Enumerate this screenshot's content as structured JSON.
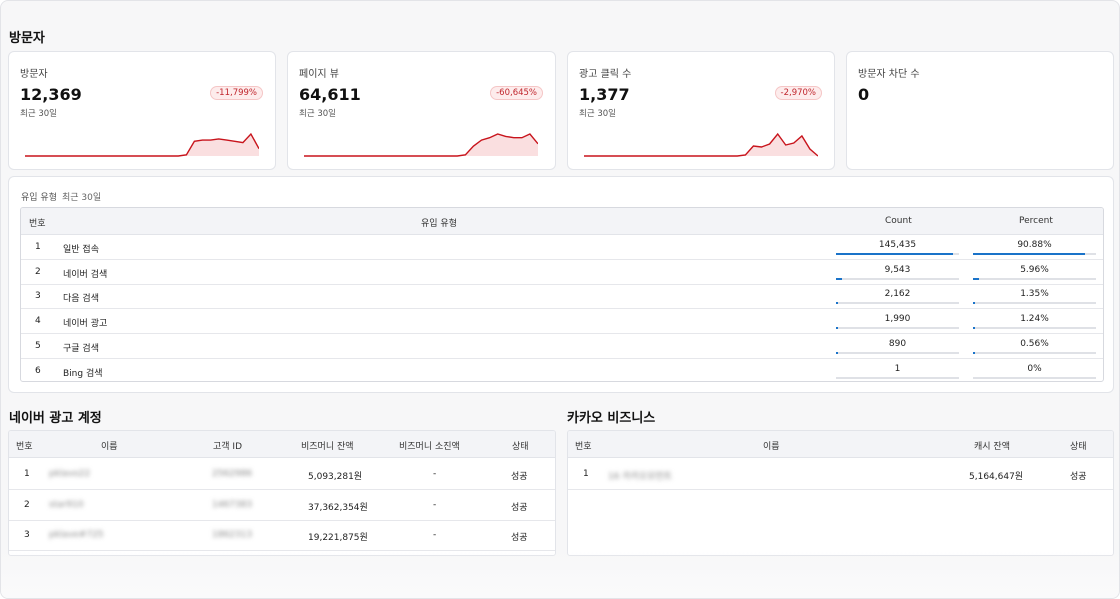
{
  "page": {
    "section_visitor": "방문자"
  },
  "kpis": [
    {
      "label": "방문자",
      "value": "12,369",
      "sub": "최근 30일",
      "badge": "-11,799%",
      "trend": [
        0,
        0,
        0,
        0,
        0,
        0,
        0,
        0,
        0,
        0,
        0,
        0,
        0,
        0,
        0,
        0,
        0,
        0,
        0,
        0,
        1,
        12,
        13,
        13,
        14,
        13,
        12,
        11,
        18,
        6
      ]
    },
    {
      "label": "페이지 뷰",
      "value": "64,611",
      "sub": "최근 30일",
      "badge": "-60,645%",
      "trend": [
        0,
        0,
        0,
        0,
        0,
        0,
        0,
        0,
        0,
        0,
        0,
        0,
        0,
        0,
        0,
        0,
        0,
        0,
        0,
        0,
        1,
        8,
        13,
        15,
        18,
        16,
        15,
        15,
        18,
        10
      ]
    },
    {
      "label": "광고 클릭 수",
      "value": "1,377",
      "sub": "최근 30일",
      "badge": "-2,970%",
      "trend": [
        0,
        0,
        0,
        0,
        0,
        0,
        0,
        0,
        0,
        0,
        0,
        0,
        0,
        0,
        0,
        0,
        0,
        0,
        0,
        0,
        1,
        10,
        9,
        12,
        22,
        11,
        13,
        20,
        7,
        0
      ]
    },
    {
      "label": "방문자 차단 수",
      "value": "0",
      "sub": "",
      "badge": "",
      "trend": []
    }
  ],
  "colors": {
    "spark_line": "#c8141c",
    "spark_fill": "#f6c9cb",
    "bar_fill": "#1a73c9"
  },
  "inflow": {
    "title": "유입 유형",
    "sub": "최근 30일",
    "headers": {
      "no": "번호",
      "type": "유입 유형",
      "count": "Count",
      "percent": "Percent"
    },
    "rows": [
      {
        "no": "1",
        "type": "일반 접속",
        "count": "145,435",
        "percent": "90.88%",
        "count_frac": 0.95,
        "pct_frac": 0.9088
      },
      {
        "no": "2",
        "type": "네이버 검색",
        "count": "9,543",
        "percent": "5.96%",
        "count_frac": 0.06,
        "pct_frac": 0.0596
      },
      {
        "no": "3",
        "type": "다음 검색",
        "count": "2,162",
        "percent": "1.35%",
        "count_frac": 0.014,
        "pct_frac": 0.0135
      },
      {
        "no": "4",
        "type": "네이버 광고",
        "count": "1,990",
        "percent": "1.24%",
        "count_frac": 0.013,
        "pct_frac": 0.0124
      },
      {
        "no": "5",
        "type": "구글 검색",
        "count": "890",
        "percent": "0.56%",
        "count_frac": 0.006,
        "pct_frac": 0.0056
      },
      {
        "no": "6",
        "type": "Bing 검색",
        "count": "1",
        "percent": "0%",
        "count_frac": 0,
        "pct_frac": 0
      }
    ]
  },
  "naver": {
    "title": "네이버 광고 계정",
    "headers": {
      "no": "번호",
      "name": "이름",
      "id": "고객 ID",
      "balance": "비즈머니 잔액",
      "spent": "비즈머니 소진액",
      "status": "상태"
    },
    "rows": [
      {
        "no": "1",
        "name": "pklavo22",
        "id": "2562986",
        "balance": "5,093,281원",
        "spent": "-",
        "status": "성공"
      },
      {
        "no": "2",
        "name": "star910",
        "id": "1467383",
        "balance": "37,362,354원",
        "spent": "-",
        "status": "성공"
      },
      {
        "no": "3",
        "name": "pklave#725",
        "id": "1862313",
        "balance": "19,221,875원",
        "spent": "-",
        "status": "성공"
      }
    ]
  },
  "kakao": {
    "title": "카카오 비즈니스",
    "headers": {
      "no": "번호",
      "name": "이름",
      "cash": "캐시 잔액",
      "status": "상태"
    },
    "rows": [
      {
        "no": "1",
        "name": "16 카카오모먼트",
        "cash": "5,164,647원",
        "status": "성공"
      }
    ]
  }
}
